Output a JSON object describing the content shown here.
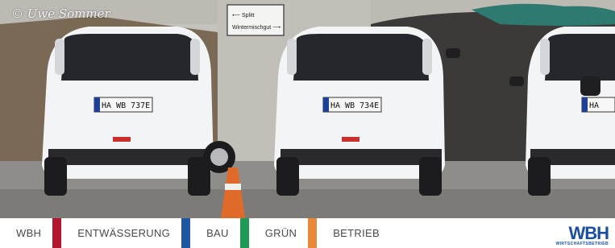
{
  "photo": {
    "credit": "© Uwe Sommer",
    "sign_line1": "⟵ Splitt",
    "sign_line2": "Wintermischgut ⟶",
    "plate_left": "HA WB 737E",
    "plate_middle": "HA WB 734E",
    "plate_right": "HA"
  },
  "nav": {
    "items": [
      {
        "label": "WBH",
        "color": "#b3162e"
      },
      {
        "label": "ENTWÄSSERUNG",
        "color": "#1f57a5"
      },
      {
        "label": "BAU",
        "color": "#1e9a56"
      },
      {
        "label": "GRÜN",
        "color": "#e8883a"
      },
      {
        "label": "BETRIEB",
        "color": ""
      }
    ]
  },
  "logo": {
    "text": "WBH",
    "subtext": "WIRTSCHAFTSBETRIEB"
  }
}
